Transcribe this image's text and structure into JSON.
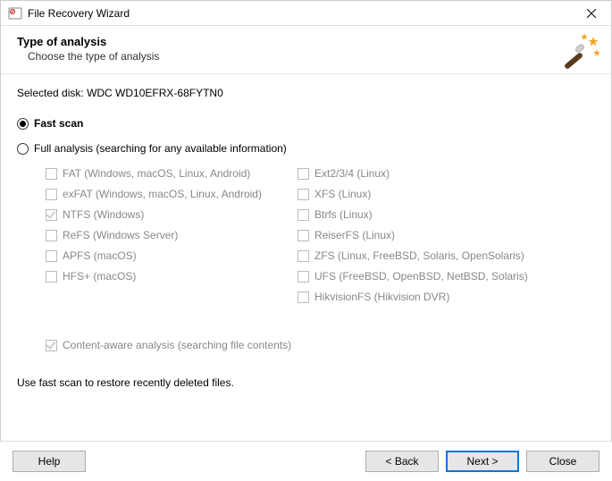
{
  "window": {
    "title": "File Recovery Wizard"
  },
  "header": {
    "title": "Type of analysis",
    "subtitle": "Choose the type of analysis"
  },
  "selectedDisk": {
    "label": "Selected disk:",
    "value": "WDC WD10EFRX-68FYTN0"
  },
  "analysis": {
    "fastScan": "Fast scan",
    "fullAnalysis": "Full analysis (searching for any available information)",
    "selected": "fast"
  },
  "fsLeft": [
    {
      "label": "FAT (Windows, macOS, Linux, Android)",
      "checked": false
    },
    {
      "label": "exFAT (Windows, macOS, Linux, Android)",
      "checked": false
    },
    {
      "label": "NTFS (Windows)",
      "checked": true
    },
    {
      "label": "ReFS (Windows Server)",
      "checked": false
    },
    {
      "label": "APFS (macOS)",
      "checked": false
    },
    {
      "label": "HFS+ (macOS)",
      "checked": false
    }
  ],
  "fsRight": [
    {
      "label": "Ext2/3/4 (Linux)",
      "checked": false
    },
    {
      "label": "XFS (Linux)",
      "checked": false
    },
    {
      "label": "Btrfs (Linux)",
      "checked": false
    },
    {
      "label": "ReiserFS (Linux)",
      "checked": false
    },
    {
      "label": "ZFS (Linux, FreeBSD, Solaris, OpenSolaris)",
      "checked": false
    },
    {
      "label": "UFS (FreeBSD, OpenBSD, NetBSD, Solaris)",
      "checked": false
    },
    {
      "label": "HikvisionFS (Hikvision DVR)",
      "checked": false
    }
  ],
  "contentAware": {
    "label": "Content-aware analysis (searching file contents)",
    "checked": true
  },
  "hint": "Use fast scan to restore recently deleted files.",
  "buttons": {
    "help": "Help",
    "back": "< Back",
    "next": "Next >",
    "close": "Close"
  }
}
